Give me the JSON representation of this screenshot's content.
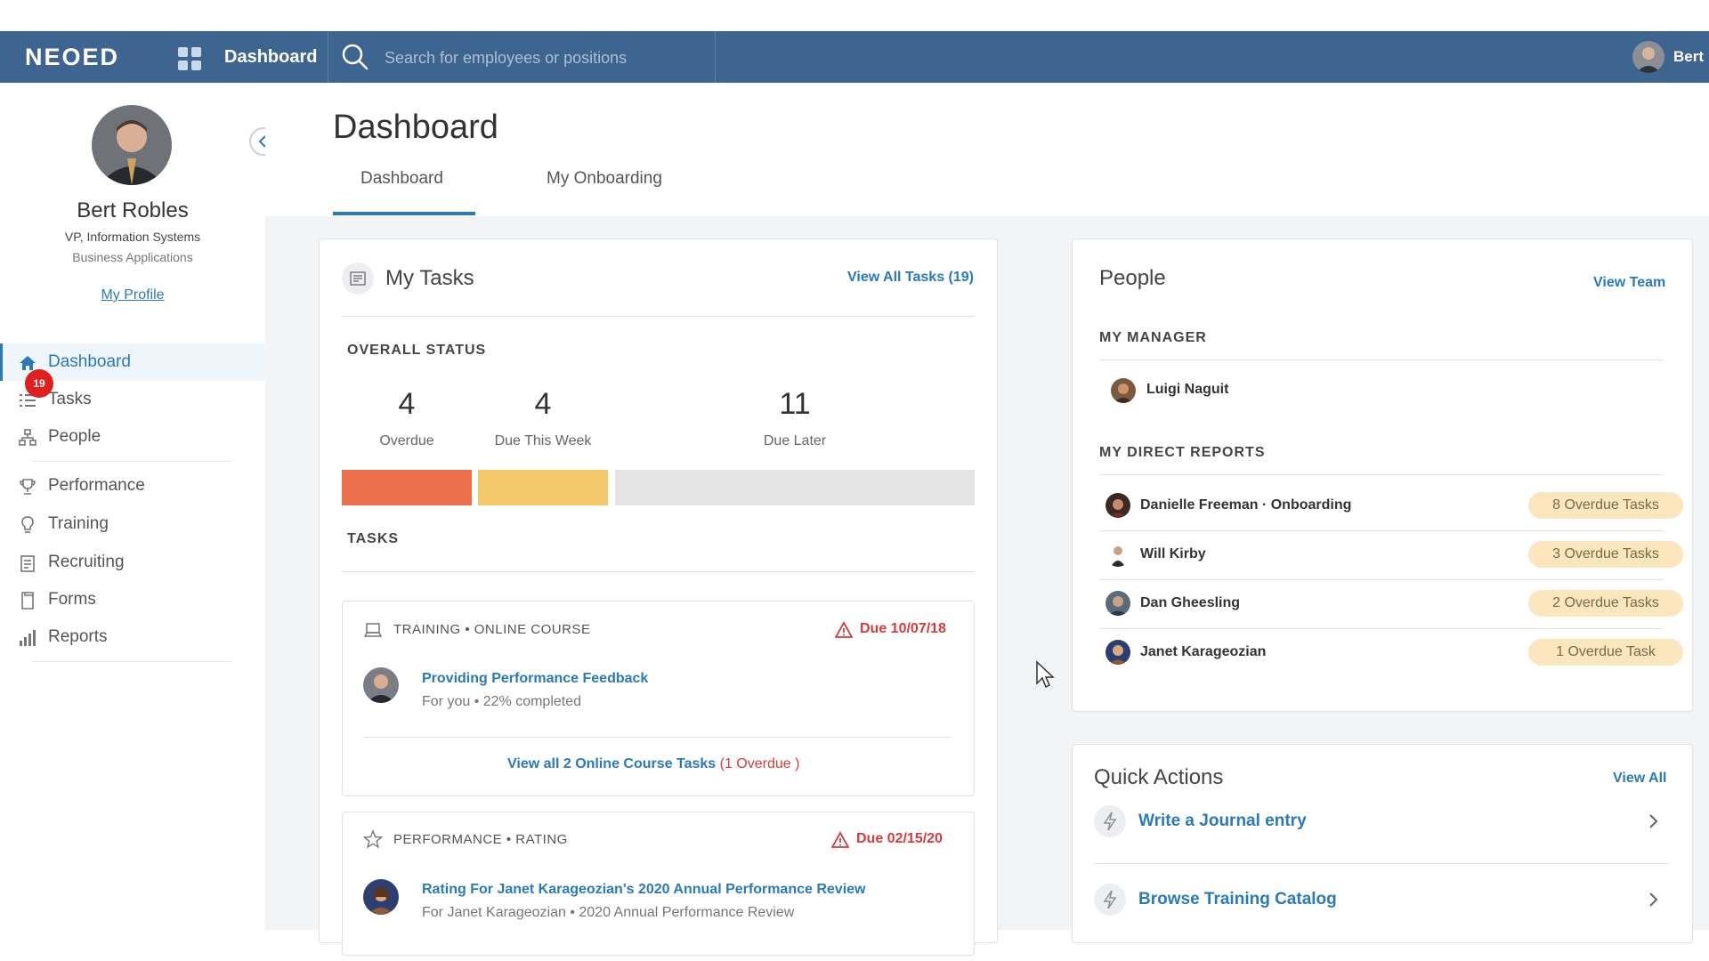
{
  "topbar": {
    "logo": "NEOED",
    "nav_label": "Dashboard",
    "search_placeholder": "Search for employees or positions",
    "user_name": "Bert"
  },
  "sidebar": {
    "profile": {
      "name": "Bert Robles",
      "title": "VP, Information Systems",
      "department": "Business Applications",
      "profile_link": "My Profile"
    },
    "tasks_badge": "19",
    "items": [
      {
        "label": "Dashboard",
        "icon": "home-icon",
        "active": true
      },
      {
        "label": "Tasks",
        "icon": "list-icon"
      },
      {
        "label": "People",
        "icon": "org-chart-icon"
      },
      {
        "label": "Performance",
        "icon": "trophy-icon"
      },
      {
        "label": "Training",
        "icon": "lightbulb-icon"
      },
      {
        "label": "Recruiting",
        "icon": "clipboard-icon"
      },
      {
        "label": "Forms",
        "icon": "document-icon"
      },
      {
        "label": "Reports",
        "icon": "bar-chart-icon"
      }
    ]
  },
  "page": {
    "title": "Dashboard",
    "tabs": [
      {
        "label": "Dashboard",
        "active": true
      },
      {
        "label": "My Onboarding"
      }
    ]
  },
  "my_tasks": {
    "title": "My Tasks",
    "view_all": "View All Tasks (19)",
    "overall_status_label": "OVERALL STATUS",
    "stats": [
      {
        "value": "4",
        "label": "Overdue",
        "color": "#ec6f4b"
      },
      {
        "value": "4",
        "label": "Due This Week",
        "color": "#f4c96b"
      },
      {
        "value": "11",
        "label": "Due Later",
        "color": "#e4e4e4"
      }
    ],
    "tasks_label": "TASKS",
    "task_cards": [
      {
        "type": "TRAINING • ONLINE COURSE",
        "type_icon": "laptop-icon",
        "due": "Due 10/07/18",
        "name": "Providing Performance Feedback",
        "sub": "For you • 22% completed",
        "view_all": "View all 2 Online Course Tasks",
        "overdue_note": "(1 Overdue )"
      },
      {
        "type": "PERFORMANCE • RATING",
        "type_icon": "star-icon",
        "due": "Due 02/15/20",
        "name": "Rating For Janet Karageozian's 2020 Annual Performance Review",
        "sub": "For Janet Karageozian • 2020 Annual Performance Review"
      }
    ]
  },
  "people": {
    "title": "People",
    "view_team": "View Team",
    "manager_label": "MY MANAGER",
    "manager": {
      "name": "Luigi Naguit"
    },
    "direct_reports_label": "MY DIRECT REPORTS",
    "direct_reports": [
      {
        "name": "Danielle Freeman · Onboarding",
        "tasks": "8 Overdue Tasks"
      },
      {
        "name": "Will Kirby",
        "tasks": "3 Overdue Tasks"
      },
      {
        "name": "Dan Gheesling",
        "tasks": "2 Overdue Tasks"
      },
      {
        "name": "Janet Karageozian",
        "tasks": "1 Overdue Task"
      }
    ]
  },
  "quick_actions": {
    "title": "Quick Actions",
    "view_all": "View All",
    "items": [
      {
        "label": "Write a Journal entry"
      },
      {
        "label": "Browse Training Catalog"
      }
    ]
  }
}
